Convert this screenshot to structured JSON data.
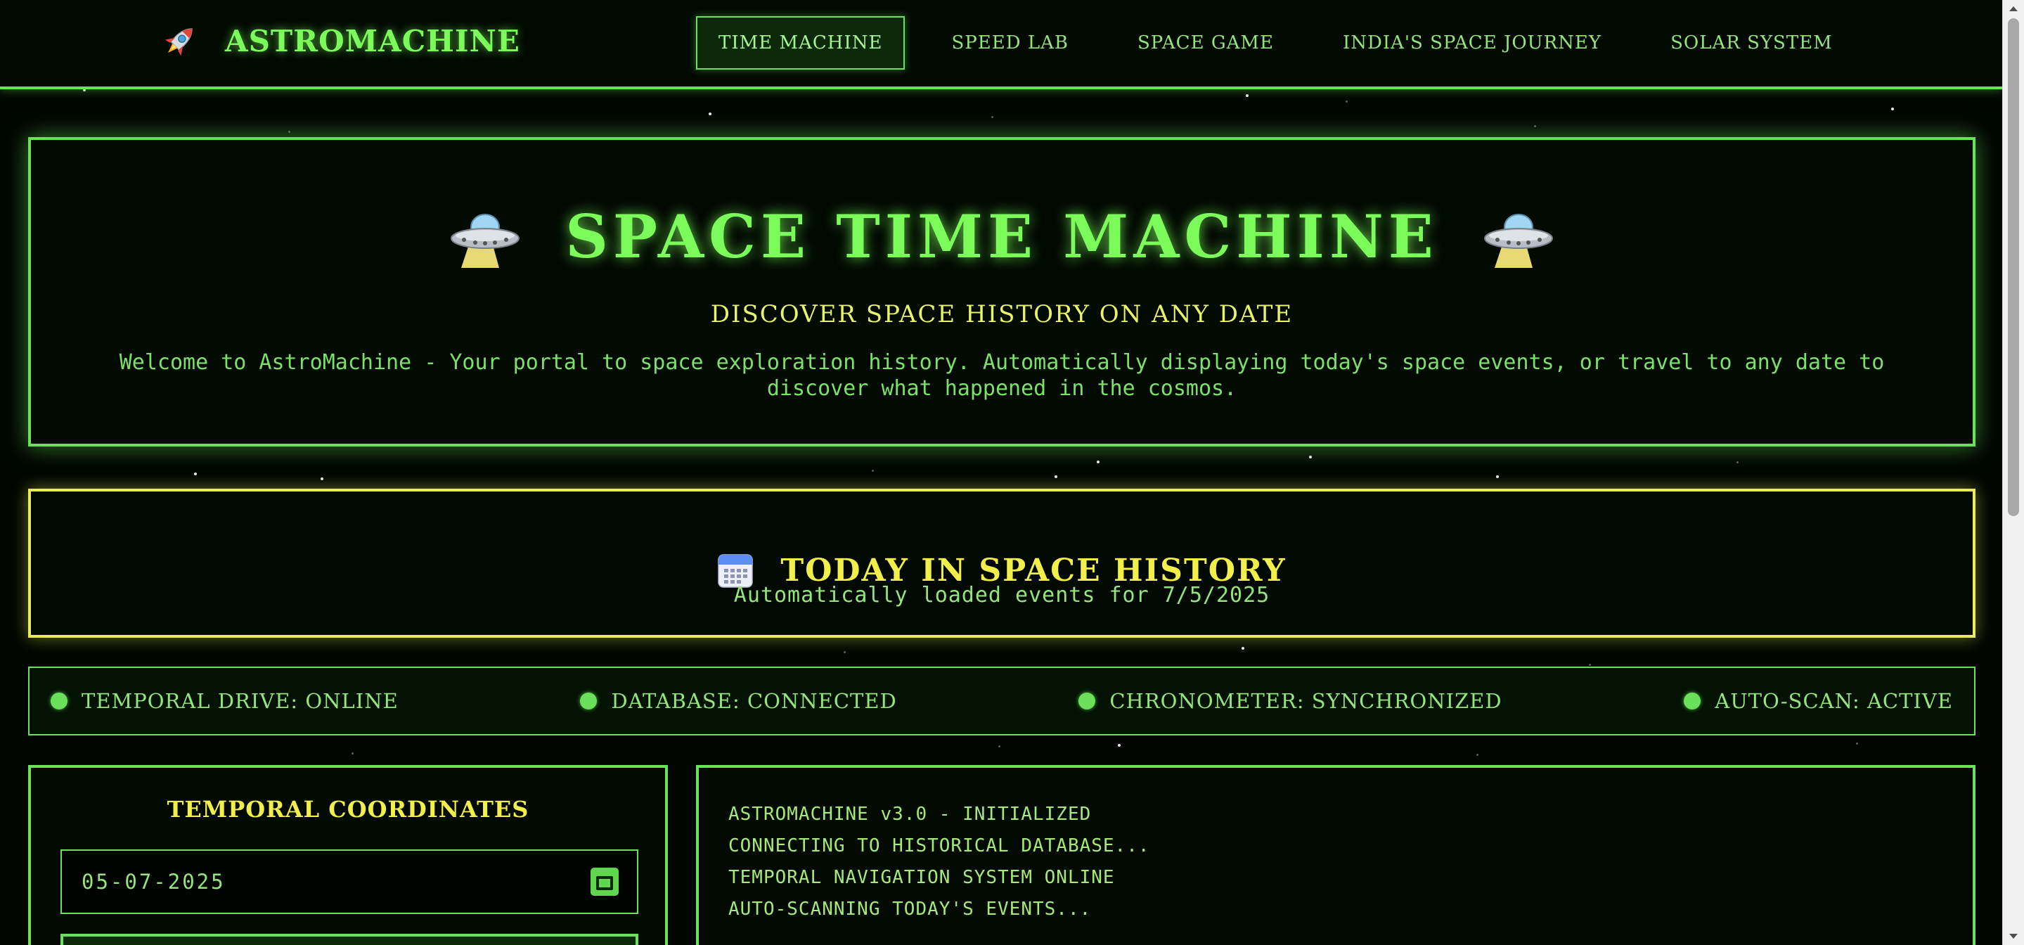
{
  "brand": {
    "name": "ASTROMACHINE",
    "icon": "rocket-icon"
  },
  "nav": {
    "items": [
      {
        "label": "TIME MACHINE",
        "active": true
      },
      {
        "label": "SPEED LAB",
        "active": false
      },
      {
        "label": "SPACE GAME",
        "active": false
      },
      {
        "label": "INDIA'S SPACE JOURNEY",
        "active": false
      },
      {
        "label": "SOLAR SYSTEM",
        "active": false
      }
    ]
  },
  "hero": {
    "title": "SPACE TIME MACHINE",
    "icon": "ufo-icon",
    "subtitle": "DISCOVER SPACE HISTORY ON ANY DATE",
    "description": "Welcome to AstroMachine - Your portal to space exploration history. Automatically displaying today's space events, or travel to any date to discover what happened in the cosmos."
  },
  "today": {
    "icon": "calendar-icon",
    "title": "TODAY IN SPACE HISTORY",
    "subtitle": "Automatically loaded events for 7/5/2025"
  },
  "status": {
    "items": [
      {
        "label": "TEMPORAL DRIVE: ONLINE"
      },
      {
        "label": "DATABASE: CONNECTED"
      },
      {
        "label": "CHRONOMETER: SYNCHRONIZED"
      },
      {
        "label": "AUTO-SCAN: ACTIVE"
      }
    ]
  },
  "coordinates": {
    "title": "TEMPORAL COORDINATES",
    "date_value": "05-07-2025"
  },
  "console": {
    "lines": [
      "ASTROMACHINE v3.0 - INITIALIZED",
      "CONNECTING TO HISTORICAL DATABASE...",
      "TEMPORAL NAVIGATION SYSTEM ONLINE",
      "AUTO-SCANNING TODAY'S EVENTS..."
    ]
  },
  "colors": {
    "accent_green": "#6BE05A",
    "accent_yellow": "#E8EC5A",
    "background": "#010601"
  }
}
